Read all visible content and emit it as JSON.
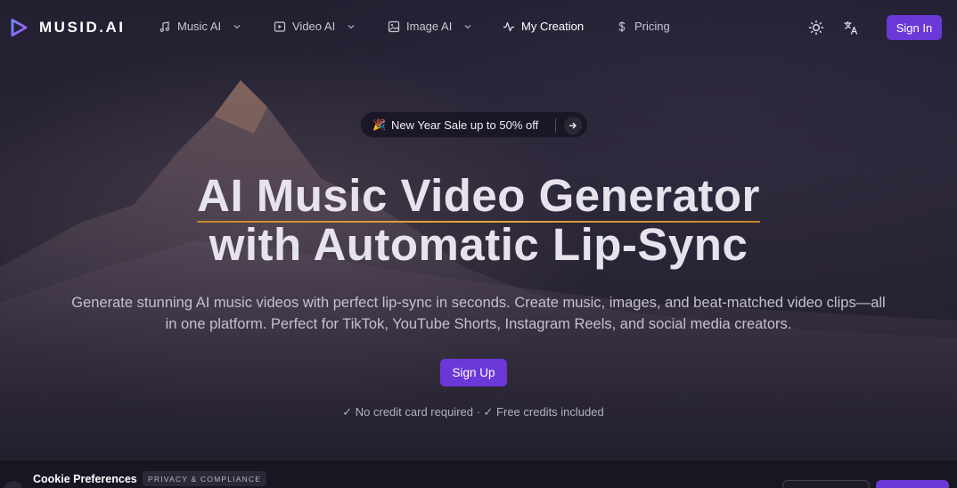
{
  "brand": {
    "name": "MUSID.AI",
    "accent": "#6a38d6",
    "underline": "#e09a35"
  },
  "nav": {
    "items": [
      {
        "label": "Music AI",
        "icon": "music-note-icon",
        "dropdown": true
      },
      {
        "label": "Video AI",
        "icon": "video-play-icon",
        "dropdown": true
      },
      {
        "label": "Image AI",
        "icon": "image-icon",
        "dropdown": true
      },
      {
        "label": "My Creation",
        "icon": "activity-icon",
        "dropdown": false
      },
      {
        "label": "Pricing",
        "icon": "dollar-icon",
        "dropdown": false
      }
    ],
    "theme_icon": "sun-icon",
    "language_icon": "translate-icon",
    "signin_label": "Sign In"
  },
  "promo": {
    "emoji": "🎉",
    "label": "New Year Sale up to 50% off",
    "icon": "arrow-right-icon"
  },
  "hero": {
    "title_line1": "AI Music Video Generator",
    "title_line2": "with Automatic Lip-Sync",
    "subtitle": "Generate stunning AI music videos with perfect lip-sync in seconds. Create music, images, and beat-matched video clips—all in one platform. Perfect for TikTok, YouTube Shorts, Instagram Reels, and social media creators.",
    "cta_label": "Sign Up",
    "note": "✓ No credit card required · ✓ Free credits included"
  },
  "cookie": {
    "title": "Cookie Preferences",
    "tag": "PRIVACY & COMPLIANCE"
  }
}
